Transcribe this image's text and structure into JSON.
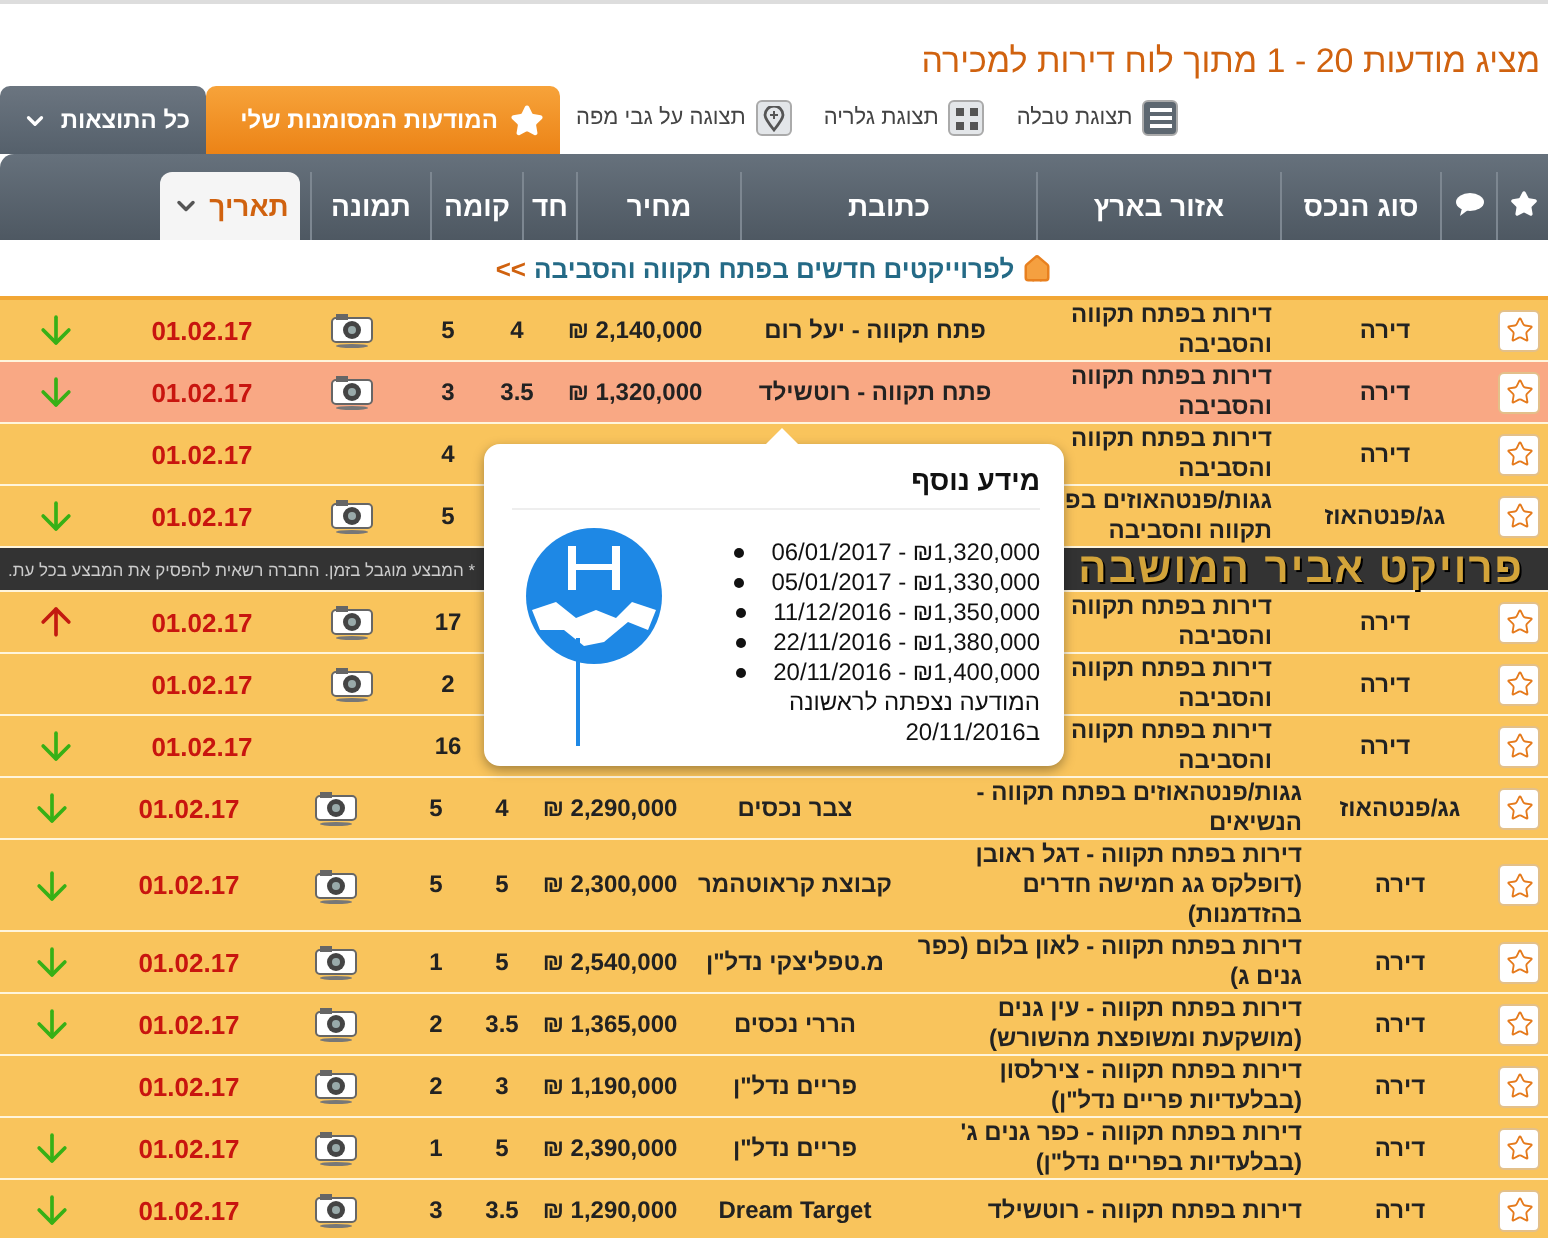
{
  "title": "מציג מודעות 20 - 1 מתוך לוח דירות למכירה",
  "views": [
    {
      "label": "תצוגת טבלה",
      "kind": "table"
    },
    {
      "label": "תצוגת גלריה",
      "kind": "gallery"
    },
    {
      "label": "תצוגה על גבי מפה",
      "kind": "map"
    }
  ],
  "result_tabs": [
    {
      "label": "המודעות המסומנות שלי",
      "kind": "starred"
    },
    {
      "label": "כל התוצאות",
      "kind": "dropdown"
    }
  ],
  "columns": [
    {
      "kind": "star",
      "selected": false
    },
    {
      "kind": "comments",
      "selected": false
    },
    {
      "kind": "text",
      "label": "סוג הנכס",
      "selected": false
    },
    {
      "kind": "text",
      "label": "אזור בארץ",
      "selected": false
    },
    {
      "kind": "text",
      "label": "כתובת",
      "selected": false
    },
    {
      "kind": "text",
      "label": "מחיר",
      "selected": false
    },
    {
      "kind": "text",
      "label": "חד",
      "selected": false
    },
    {
      "kind": "text",
      "label": "קומה",
      "selected": false
    },
    {
      "kind": "text",
      "label": "תמונה",
      "selected": false
    },
    {
      "kind": "text",
      "label": "תאריך",
      "selected": true
    }
  ],
  "projects_link": {
    "label": "לפרוייקטים חדשים בפתח תקווה והסביבה",
    "arrows": ">>"
  },
  "project_table": {
    "rows": [
      {
        "kind": "listing",
        "selected": false,
        "type": "דירה",
        "area": "דירות בפתח תקווה\nוהסביבה",
        "address": "פתח תקווה - יעל רום",
        "price": "2,140,000 ₪",
        "rooms": "4",
        "floor": "5",
        "photo": true,
        "date": "01.02.17",
        "price_down": true,
        "price_up": false
      },
      {
        "kind": "listing",
        "selected": true,
        "type": "דירה",
        "area": "דירות בפתח תקווה\nוהסביבה",
        "address": "פתח תקווה - רוטשילד",
        "price": "1,320,000 ₪",
        "rooms": "3.5",
        "floor": "3",
        "photo": true,
        "date": "01.02.17",
        "price_down": true,
        "price_up": false
      },
      {
        "kind": "listing",
        "selected": false,
        "type": "דירה",
        "area": "דירות בפתח תקווה\nוהסביבה",
        "floor": "4",
        "photo": false,
        "date": "01.02.17",
        "price_down": false,
        "price_up": false
      },
      {
        "kind": "listing",
        "selected": false,
        "type": "גג/פנטהאוז",
        "area": "גגות/פנטהאוזים בפ\nתקווה והסביבה",
        "floor": "5",
        "photo": true,
        "date": "01.02.17",
        "price_down": true,
        "price_up": false
      },
      {
        "kind": "banner",
        "title": "פרויקט אביר המושבה",
        "note": "* המבצע מוגבל בזמן. החברה רשאית להפסיק את המבצע בכל עת."
      },
      {
        "kind": "listing",
        "selected": false,
        "type": "דירה",
        "area": "דירות בפתח תקווה\nוהסביבה",
        "floor": "17",
        "photo": true,
        "date": "01.02.17",
        "price_down": false,
        "price_up": true
      },
      {
        "kind": "listing",
        "selected": false,
        "type": "דירה",
        "area": "דירות בפתח תקווה\nוהסביבה",
        "floor": "2",
        "photo": true,
        "date": "01.02.17",
        "price_down": false,
        "price_up": false
      },
      {
        "kind": "listing",
        "selected": false,
        "type": "דירה",
        "area": "דירות בפתח תקווה\nוהסביבה",
        "floor": "16",
        "photo": false,
        "date": "01.02.17",
        "price_down": true,
        "price_up": false
      }
    ]
  },
  "popup": {
    "title": "מידע נוסף",
    "history": [
      "06/01/2017 - ₪1,320,000",
      "05/01/2017 - ₪1,330,000",
      "11/12/2016 - ₪1,350,000",
      "22/11/2016 - ₪1,380,000",
      "20/11/2016 - ₪1,400,000"
    ],
    "first_seen": "המודעה נצפתה לראשונה ב20/11/2016"
  },
  "table": {
    "rows": [
      {
        "kind": "listing",
        "selected": false,
        "type": "גג/פנטהאוז",
        "area": "גגות/פנטהאוזים בפתח תקווה -\nהנשיאים",
        "address": "צבר נכסים",
        "price": "2,290,000 ₪",
        "rooms": "4",
        "floor": "5",
        "photo": true,
        "date": "01.02.17",
        "price_down": true,
        "price_up": false
      },
      {
        "kind": "listing",
        "selected": false,
        "type": "דירה",
        "area": "דירות בפתח תקווה - דגל ראובן\n(דופלקס גג חמישה חדרים\nבהזדמנות)",
        "address": "קבוצת קראוטהמר",
        "price": "2,300,000 ₪",
        "rooms": "5",
        "floor": "5",
        "photo": true,
        "date": "01.02.17",
        "price_down": true,
        "price_up": false
      },
      {
        "kind": "listing",
        "selected": false,
        "type": "דירה",
        "area": "דירות בפתח תקווה - לאון בלום (כפר\nגנים ג)",
        "address": "מ.טפליצקי נדל\"ן",
        "price": "2,540,000 ₪",
        "rooms": "5",
        "floor": "1",
        "photo": true,
        "date": "01.02.17",
        "price_down": true,
        "price_up": false
      },
      {
        "kind": "listing",
        "selected": false,
        "type": "דירה",
        "area": "דירות בפתח תקווה - עין גנים\n(מושקעת ומשופצת מהשורש)",
        "address": "הררי נכסים",
        "price": "1,365,000 ₪",
        "rooms": "3.5",
        "floor": "2",
        "photo": true,
        "date": "01.02.17",
        "price_down": true,
        "price_up": false
      },
      {
        "kind": "listing",
        "selected": false,
        "type": "דירה",
        "area": "דירות בפתח תקווה - צירלסון\n(בבלעדיות פריים נדל\"ן)",
        "address": "פריים נדל\"ן",
        "price": "1,190,000 ₪",
        "rooms": "3",
        "floor": "2",
        "photo": true,
        "date": "01.02.17",
        "price_down": false,
        "price_up": false
      },
      {
        "kind": "listing",
        "selected": false,
        "type": "דירה",
        "area": "דירות בפתח תקווה - כפר גנים ג'\n(בבלעדיות בפריים נדל\"ן)",
        "address": "פריים נדל\"ן",
        "price": "2,390,000 ₪",
        "rooms": "5",
        "floor": "1",
        "photo": true,
        "date": "01.02.17",
        "price_down": true,
        "price_up": false
      },
      {
        "kind": "listing",
        "selected": false,
        "type": "דירה",
        "area": "דירות בפתח תקווה - רוטשילד",
        "address": "Dream Target",
        "price": "1,290,000 ₪",
        "rooms": "3.5",
        "floor": "3",
        "photo": true,
        "date": "01.02.17",
        "price_down": true,
        "price_up": false
      }
    ]
  }
}
